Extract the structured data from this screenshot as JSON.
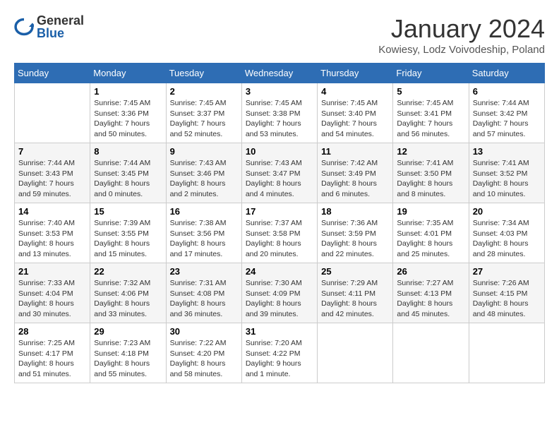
{
  "header": {
    "logo_general": "General",
    "logo_blue": "Blue",
    "month_title": "January 2024",
    "location": "Kowiesy, Lodz Voivodeship, Poland"
  },
  "weekdays": [
    "Sunday",
    "Monday",
    "Tuesday",
    "Wednesday",
    "Thursday",
    "Friday",
    "Saturday"
  ],
  "weeks": [
    [
      {
        "num": "",
        "sunrise": "",
        "sunset": "",
        "daylight": ""
      },
      {
        "num": "1",
        "sunrise": "Sunrise: 7:45 AM",
        "sunset": "Sunset: 3:36 PM",
        "daylight": "Daylight: 7 hours and 50 minutes."
      },
      {
        "num": "2",
        "sunrise": "Sunrise: 7:45 AM",
        "sunset": "Sunset: 3:37 PM",
        "daylight": "Daylight: 7 hours and 52 minutes."
      },
      {
        "num": "3",
        "sunrise": "Sunrise: 7:45 AM",
        "sunset": "Sunset: 3:38 PM",
        "daylight": "Daylight: 7 hours and 53 minutes."
      },
      {
        "num": "4",
        "sunrise": "Sunrise: 7:45 AM",
        "sunset": "Sunset: 3:40 PM",
        "daylight": "Daylight: 7 hours and 54 minutes."
      },
      {
        "num": "5",
        "sunrise": "Sunrise: 7:45 AM",
        "sunset": "Sunset: 3:41 PM",
        "daylight": "Daylight: 7 hours and 56 minutes."
      },
      {
        "num": "6",
        "sunrise": "Sunrise: 7:44 AM",
        "sunset": "Sunset: 3:42 PM",
        "daylight": "Daylight: 7 hours and 57 minutes."
      }
    ],
    [
      {
        "num": "7",
        "sunrise": "Sunrise: 7:44 AM",
        "sunset": "Sunset: 3:43 PM",
        "daylight": "Daylight: 7 hours and 59 minutes."
      },
      {
        "num": "8",
        "sunrise": "Sunrise: 7:44 AM",
        "sunset": "Sunset: 3:45 PM",
        "daylight": "Daylight: 8 hours and 0 minutes."
      },
      {
        "num": "9",
        "sunrise": "Sunrise: 7:43 AM",
        "sunset": "Sunset: 3:46 PM",
        "daylight": "Daylight: 8 hours and 2 minutes."
      },
      {
        "num": "10",
        "sunrise": "Sunrise: 7:43 AM",
        "sunset": "Sunset: 3:47 PM",
        "daylight": "Daylight: 8 hours and 4 minutes."
      },
      {
        "num": "11",
        "sunrise": "Sunrise: 7:42 AM",
        "sunset": "Sunset: 3:49 PM",
        "daylight": "Daylight: 8 hours and 6 minutes."
      },
      {
        "num": "12",
        "sunrise": "Sunrise: 7:41 AM",
        "sunset": "Sunset: 3:50 PM",
        "daylight": "Daylight: 8 hours and 8 minutes."
      },
      {
        "num": "13",
        "sunrise": "Sunrise: 7:41 AM",
        "sunset": "Sunset: 3:52 PM",
        "daylight": "Daylight: 8 hours and 10 minutes."
      }
    ],
    [
      {
        "num": "14",
        "sunrise": "Sunrise: 7:40 AM",
        "sunset": "Sunset: 3:53 PM",
        "daylight": "Daylight: 8 hours and 13 minutes."
      },
      {
        "num": "15",
        "sunrise": "Sunrise: 7:39 AM",
        "sunset": "Sunset: 3:55 PM",
        "daylight": "Daylight: 8 hours and 15 minutes."
      },
      {
        "num": "16",
        "sunrise": "Sunrise: 7:38 AM",
        "sunset": "Sunset: 3:56 PM",
        "daylight": "Daylight: 8 hours and 17 minutes."
      },
      {
        "num": "17",
        "sunrise": "Sunrise: 7:37 AM",
        "sunset": "Sunset: 3:58 PM",
        "daylight": "Daylight: 8 hours and 20 minutes."
      },
      {
        "num": "18",
        "sunrise": "Sunrise: 7:36 AM",
        "sunset": "Sunset: 3:59 PM",
        "daylight": "Daylight: 8 hours and 22 minutes."
      },
      {
        "num": "19",
        "sunrise": "Sunrise: 7:35 AM",
        "sunset": "Sunset: 4:01 PM",
        "daylight": "Daylight: 8 hours and 25 minutes."
      },
      {
        "num": "20",
        "sunrise": "Sunrise: 7:34 AM",
        "sunset": "Sunset: 4:03 PM",
        "daylight": "Daylight: 8 hours and 28 minutes."
      }
    ],
    [
      {
        "num": "21",
        "sunrise": "Sunrise: 7:33 AM",
        "sunset": "Sunset: 4:04 PM",
        "daylight": "Daylight: 8 hours and 30 minutes."
      },
      {
        "num": "22",
        "sunrise": "Sunrise: 7:32 AM",
        "sunset": "Sunset: 4:06 PM",
        "daylight": "Daylight: 8 hours and 33 minutes."
      },
      {
        "num": "23",
        "sunrise": "Sunrise: 7:31 AM",
        "sunset": "Sunset: 4:08 PM",
        "daylight": "Daylight: 8 hours and 36 minutes."
      },
      {
        "num": "24",
        "sunrise": "Sunrise: 7:30 AM",
        "sunset": "Sunset: 4:09 PM",
        "daylight": "Daylight: 8 hours and 39 minutes."
      },
      {
        "num": "25",
        "sunrise": "Sunrise: 7:29 AM",
        "sunset": "Sunset: 4:11 PM",
        "daylight": "Daylight: 8 hours and 42 minutes."
      },
      {
        "num": "26",
        "sunrise": "Sunrise: 7:27 AM",
        "sunset": "Sunset: 4:13 PM",
        "daylight": "Daylight: 8 hours and 45 minutes."
      },
      {
        "num": "27",
        "sunrise": "Sunrise: 7:26 AM",
        "sunset": "Sunset: 4:15 PM",
        "daylight": "Daylight: 8 hours and 48 minutes."
      }
    ],
    [
      {
        "num": "28",
        "sunrise": "Sunrise: 7:25 AM",
        "sunset": "Sunset: 4:17 PM",
        "daylight": "Daylight: 8 hours and 51 minutes."
      },
      {
        "num": "29",
        "sunrise": "Sunrise: 7:23 AM",
        "sunset": "Sunset: 4:18 PM",
        "daylight": "Daylight: 8 hours and 55 minutes."
      },
      {
        "num": "30",
        "sunrise": "Sunrise: 7:22 AM",
        "sunset": "Sunset: 4:20 PM",
        "daylight": "Daylight: 8 hours and 58 minutes."
      },
      {
        "num": "31",
        "sunrise": "Sunrise: 7:20 AM",
        "sunset": "Sunset: 4:22 PM",
        "daylight": "Daylight: 9 hours and 1 minute."
      },
      {
        "num": "",
        "sunrise": "",
        "sunset": "",
        "daylight": ""
      },
      {
        "num": "",
        "sunrise": "",
        "sunset": "",
        "daylight": ""
      },
      {
        "num": "",
        "sunrise": "",
        "sunset": "",
        "daylight": ""
      }
    ]
  ]
}
